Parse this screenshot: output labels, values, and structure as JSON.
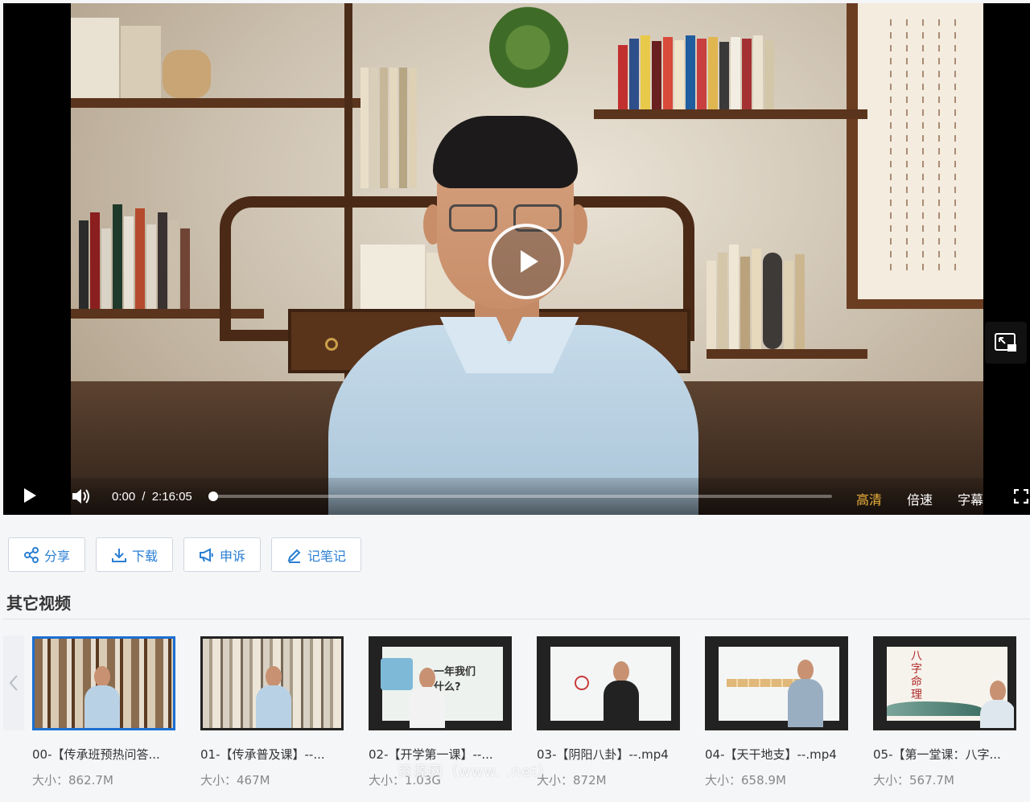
{
  "player": {
    "time_current": "0:00",
    "time_separator": "/",
    "time_total": "2:16:05",
    "progress": 0,
    "quality_label": "高清",
    "speed_label": "倍速",
    "subtitle_label": "字幕",
    "active_color": "#f0b43c",
    "big_play_icon": "play-circle-icon",
    "pip_icon": "picture-in-picture-icon"
  },
  "actions": [
    {
      "label": "分享",
      "icon": "share-icon"
    },
    {
      "label": "下载",
      "icon": "download-icon"
    },
    {
      "label": "申诉",
      "icon": "megaphone-icon"
    },
    {
      "label": "记笔记",
      "icon": "pencil-icon"
    }
  ],
  "accent_color": "#2a7fd4",
  "section": {
    "title": "其它视频"
  },
  "videos": [
    {
      "name": "00-【传承班预热问答...",
      "size": "大小：862.7M",
      "selected": true
    },
    {
      "name": "01-【传承普及课】--...",
      "size": "大小：467M",
      "selected": false
    },
    {
      "name": "02-【开学第一课】--...",
      "size": "大小：1.03G",
      "selected": false,
      "thumb_text": "一年我们\n什么?"
    },
    {
      "name": "03-【阴阳八卦】--.mp4",
      "size": "大小：872M",
      "selected": false
    },
    {
      "name": "04-【天干地支】--.mp4",
      "size": "大小：658.9M",
      "selected": false
    },
    {
      "name": "05-【第一堂课：八字...",
      "size": "大小：567.7M",
      "selected": false,
      "thumb_text": "八字命理"
    }
  ],
  "watermark": "资源网（www.    .net）"
}
